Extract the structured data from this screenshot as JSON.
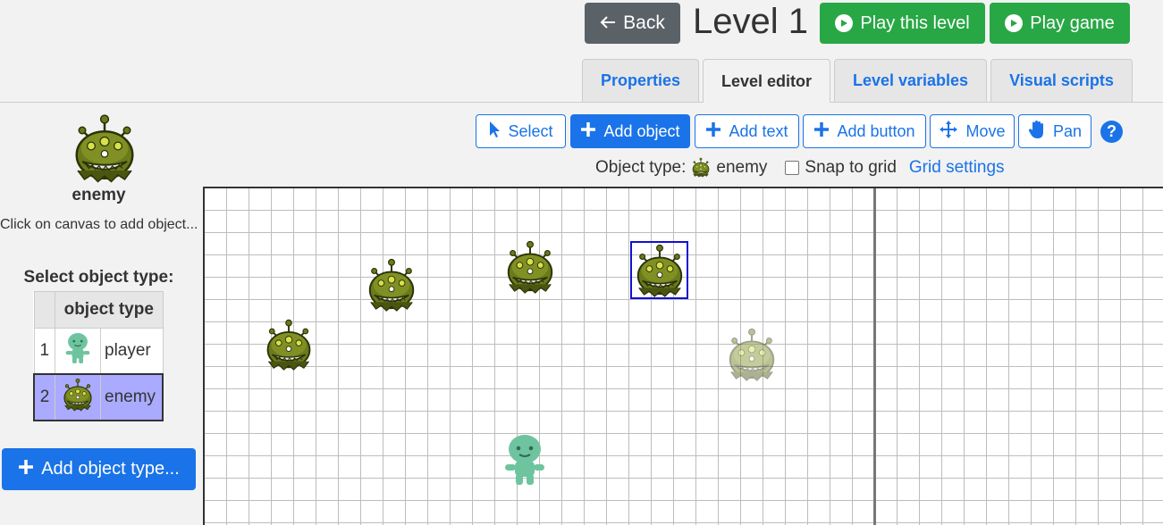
{
  "header": {
    "back_label": "Back",
    "level_title": "Level 1",
    "play_level_label": "Play this level",
    "play_game_label": "Play game"
  },
  "tabs": [
    {
      "label": "Properties",
      "active": false
    },
    {
      "label": "Level editor",
      "active": true
    },
    {
      "label": "Level variables",
      "active": false
    },
    {
      "label": "Visual scripts",
      "active": false
    }
  ],
  "toolbar": {
    "select_label": "Select",
    "add_object_label": "Add object",
    "add_text_label": "Add text",
    "add_button_label": "Add button",
    "move_label": "Move",
    "pan_label": "Pan",
    "help_label": "?",
    "active_tool": "Add object"
  },
  "object_type_row": {
    "prefix": "Object type:",
    "current_type": "enemy",
    "snap_label": "Snap to grid",
    "snap_checked": false,
    "grid_settings_label": "Grid settings"
  },
  "sidebar": {
    "current_name": "enemy",
    "hint": "Click on canvas to add object...",
    "select_heading": "Select object type:",
    "table_header": "object type",
    "rows": [
      {
        "num": "1",
        "name": "player",
        "icon": "player-sprite",
        "selected": false
      },
      {
        "num": "2",
        "name": "enemy",
        "icon": "enemy-sprite",
        "selected": true
      }
    ],
    "add_type_label": "Add object type..."
  },
  "colors": {
    "accent": "#1a73e8",
    "green": "#28a745",
    "back": "#5a6268",
    "selected_row": "#aaaaff",
    "enemy_body": "#6b7a1a",
    "player_body": "#6fc4a0"
  }
}
